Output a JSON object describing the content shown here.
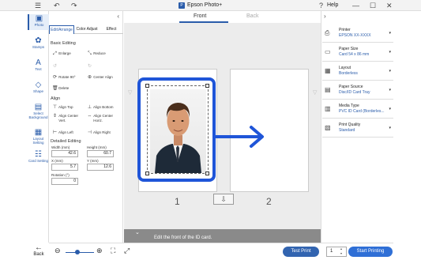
{
  "titlebar": {
    "menu_icon": "hamburger-icon",
    "undo_icon": "undo-icon",
    "redo_icon": "redo-icon",
    "title": "Epson Photo+",
    "help": "Help",
    "minimize": "—",
    "maximize": "☐",
    "close": "✕"
  },
  "rail": {
    "items": [
      {
        "label": "Photo",
        "icon": "photo-icon"
      },
      {
        "label": "Stamps",
        "icon": "stamps-icon"
      },
      {
        "label": "Text",
        "icon": "text-icon"
      },
      {
        "label": "Shape",
        "icon": "shape-icon"
      },
      {
        "label": "Select Background",
        "icon": "background-icon"
      },
      {
        "label": "Layout Setting",
        "icon": "layout-setting-icon"
      },
      {
        "label": "Card Setting",
        "icon": "card-setting-icon"
      }
    ],
    "back_label": "Back"
  },
  "left_panel": {
    "tabs": [
      "Edit/Arrange",
      "Color Adjust",
      "Effect"
    ],
    "basic_editing": "Basic Editing",
    "tools": {
      "enlarge": "Enlarge",
      "reduce": "Reduce",
      "rotate": "Rotate 90°",
      "center_align": "Center Align",
      "delete": "Delete"
    },
    "align": "Align",
    "align_tools": {
      "align_top": "Align Top",
      "align_bottom": "Align Bottom",
      "align_center_vert": "Align Center Vert.",
      "align_center_horiz": "Align Center Horiz.",
      "align_left": "Align Left",
      "align_right": "Align Right"
    },
    "detailed_editing": "Detailed Editing",
    "fields": {
      "width_label": "Width (mm)",
      "width_value": "42.6",
      "height_label": "Height (mm)",
      "height_value": "60.7",
      "x_label": "X (mm)",
      "x_value": "5.7",
      "y_label": "Y (mm)",
      "y_value": "12.6",
      "rotation_label": "Rotation (°)",
      "rotation_value": "0"
    }
  },
  "canvas": {
    "tab_front": "Front",
    "tab_back": "Back",
    "page1": "1",
    "page2": "2",
    "hint": "Edit the front of the ID card."
  },
  "right_panel": {
    "settings": [
      {
        "title": "Printer",
        "value": "EPSON XX-XXXX",
        "icon": "printer-icon"
      },
      {
        "title": "Paper Size",
        "value": "Card 54 x 86 mm",
        "icon": "paper-size-icon"
      },
      {
        "title": "Layout",
        "value": "Borderless",
        "icon": "layout-icon"
      },
      {
        "title": "Paper Source",
        "value": "Disc/ID Card Tray",
        "icon": "paper-source-icon"
      },
      {
        "title": "Media Type",
        "value": "PVC ID Card (Borderles...",
        "icon": "media-type-icon"
      },
      {
        "title": "Print Quality",
        "value": "Standard",
        "icon": "print-quality-icon"
      }
    ]
  },
  "bottom": {
    "test_print": "Test Print",
    "copies": "1",
    "start_printing": "Start Printing"
  },
  "colors": {
    "accent": "#2a5caa",
    "highlight": "#1f55d8",
    "hint_bar": "#8a8a8a"
  }
}
